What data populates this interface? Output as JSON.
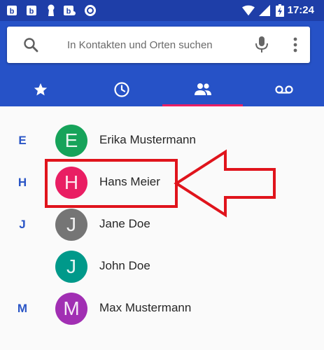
{
  "status_bar": {
    "time": "17:24",
    "icons": [
      "notification-b-icon",
      "notification-b-icon",
      "keyhole-icon",
      "notification-b-icon",
      "circle-icon",
      "wifi-icon",
      "signal-icon",
      "battery-charging-icon"
    ]
  },
  "search": {
    "placeholder": "In Kontakten und Orten suchen",
    "value": ""
  },
  "tabs": [
    {
      "id": "favorites",
      "icon": "star-icon",
      "selected": false
    },
    {
      "id": "recents",
      "icon": "clock-icon",
      "selected": false
    },
    {
      "id": "contacts",
      "icon": "people-icon",
      "selected": true
    },
    {
      "id": "voicemail",
      "icon": "voicemail-icon",
      "selected": false
    }
  ],
  "colors": {
    "status_bar": "#1e3ea8",
    "app_bar": "#2652c7",
    "tab_indicator": "#e91e63",
    "section_letter": "#2a55c6",
    "highlight": "#e0141c"
  },
  "contacts": [
    {
      "section": "E",
      "initial": "E",
      "name": "Erika Mustermann",
      "avatar_color": "#16a35a"
    },
    {
      "section": "H",
      "initial": "H",
      "name": "Hans Meier",
      "avatar_color": "#e91e63",
      "highlighted": true
    },
    {
      "section": "J",
      "initial": "J",
      "name": "Jane Doe",
      "avatar_color": "#757575"
    },
    {
      "section": "",
      "initial": "J",
      "name": "John Doe",
      "avatar_color": "#00998a"
    },
    {
      "section": "M",
      "initial": "M",
      "name": "Max Mustermann",
      "avatar_color": "#a12fb3"
    }
  ]
}
